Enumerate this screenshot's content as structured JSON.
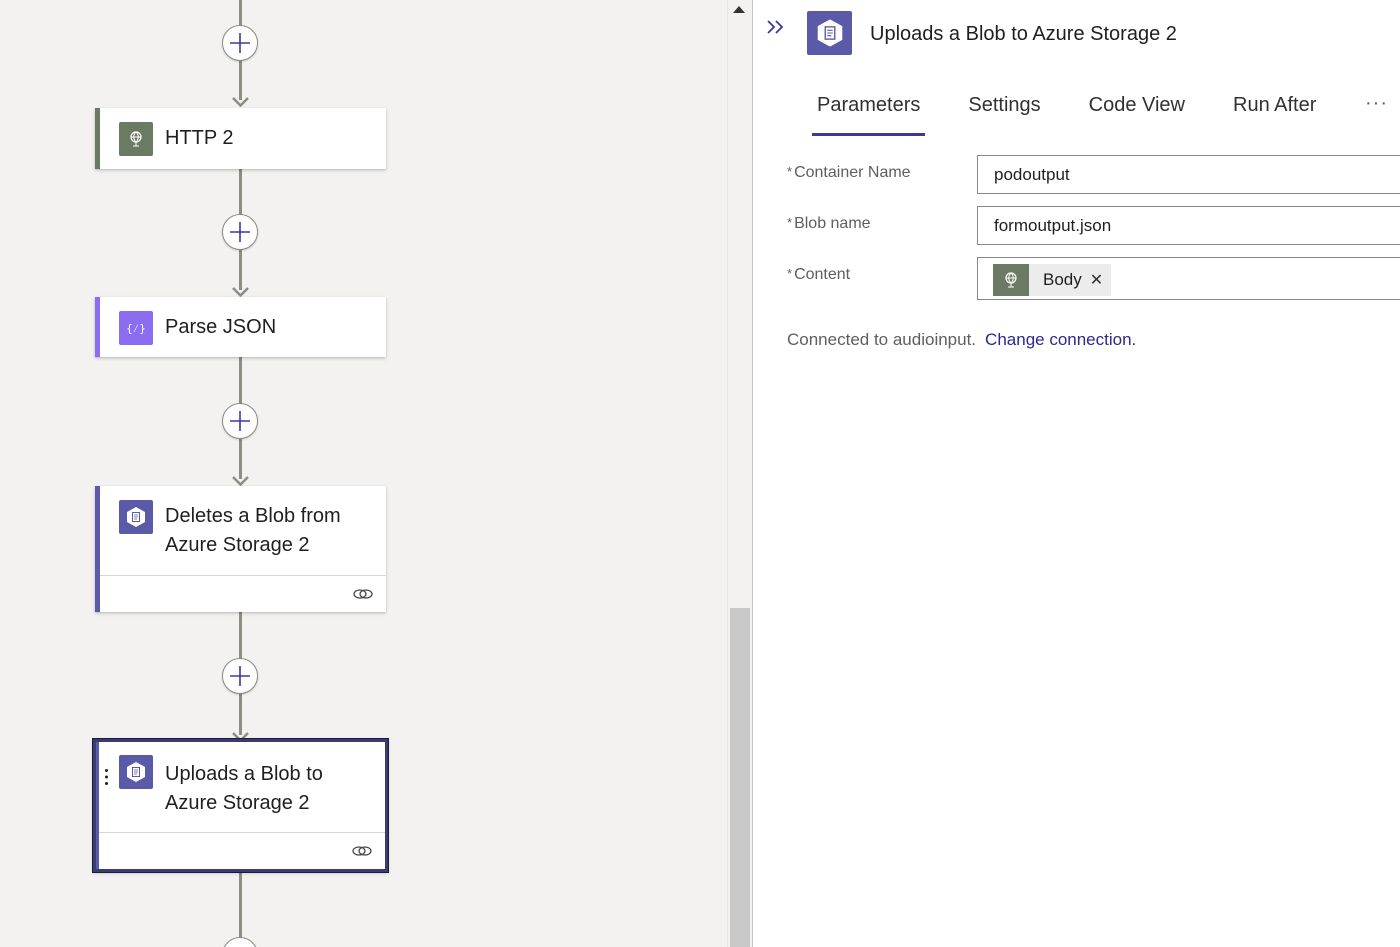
{
  "canvas": {
    "nodes": [
      {
        "id": "http2",
        "title_lines": [
          "HTTP 2"
        ],
        "icon": "globe-icon",
        "accent": "#6b7a62",
        "has_footer": false,
        "selected": false
      },
      {
        "id": "parse-json",
        "title_lines": [
          "Parse JSON"
        ],
        "icon": "braces-icon",
        "accent": "#8c6cf0",
        "has_footer": false,
        "selected": false
      },
      {
        "id": "delete-blob",
        "title_lines": [
          "Deletes a Blob from",
          "Azure Storage 2"
        ],
        "icon": "blob-storage-icon",
        "accent": "#5a5aa8",
        "has_footer": true,
        "selected": false
      },
      {
        "id": "upload-blob",
        "title_lines": [
          "Uploads a Blob to",
          "Azure Storage 2"
        ],
        "icon": "blob-storage-icon",
        "accent": "#5a5aa8",
        "has_footer": true,
        "selected": true
      }
    ]
  },
  "panel": {
    "title": "Uploads a Blob to Azure Storage 2",
    "tabs": [
      {
        "label": "Parameters",
        "active": true
      },
      {
        "label": "Settings",
        "active": false
      },
      {
        "label": "Code View",
        "active": false
      },
      {
        "label": "Run After",
        "active": false
      }
    ],
    "more_label": "···",
    "fields": {
      "container_name": {
        "label": "Container Name",
        "required": "*",
        "value": "podoutput"
      },
      "blob_name": {
        "label": "Blob name",
        "required": "*",
        "value": "formoutput.json"
      },
      "content": {
        "label": "Content",
        "required": "*",
        "token": {
          "label": "Body",
          "icon": "globe-icon",
          "remove": "✕"
        }
      }
    },
    "connection": {
      "text": "Connected to audioinput.",
      "link": "Change connection."
    }
  },
  "colors": {
    "accent_purple": "#3b3a9c",
    "connector": "#8a8f82",
    "http_green": "#6b7a62",
    "parse_purple": "#8c6cf0",
    "storage_blue": "#5a5aa8"
  }
}
